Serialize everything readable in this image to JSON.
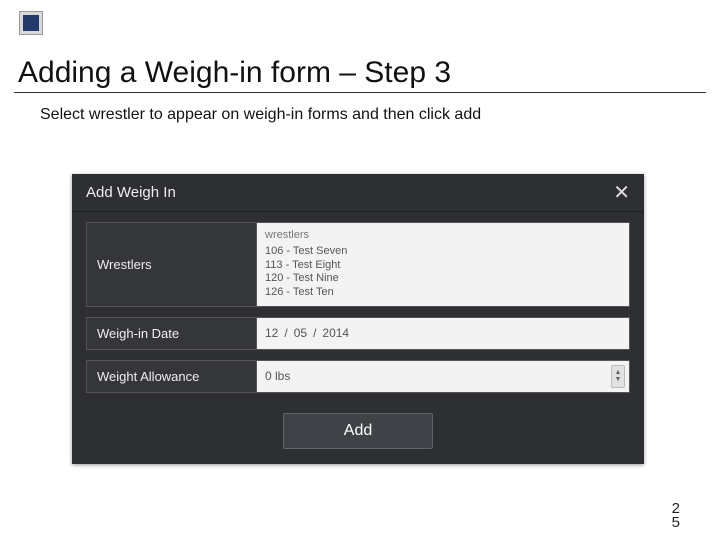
{
  "title": "Adding a Weigh-in form – Step 3",
  "subtitle": "Select wrestler to appear on weigh-in forms and then click add",
  "dialog": {
    "header": "Add Weigh In",
    "labels": {
      "wrestlers": "Wrestlers",
      "weighInDate": "Weigh-in Date",
      "weightAllowance": "Weight Allowance"
    },
    "wrestlers": {
      "caption": "wrestlers",
      "items": [
        "106 - Test Seven",
        "113 - Test Eight",
        "120 - Test Nine",
        "126 - Test Ten"
      ]
    },
    "date": {
      "mm": "12",
      "dd": "05",
      "yyyy": "2014",
      "sepA": "/",
      "sepB": "/"
    },
    "allowance": "0 lbs",
    "addButton": "Add"
  },
  "pageNum": {
    "a": "2",
    "b": "5"
  }
}
